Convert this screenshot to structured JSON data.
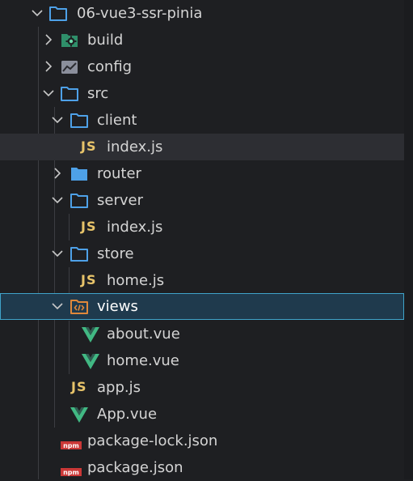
{
  "colors": {
    "background": "#1e1f22",
    "hover_row": "#2d2e33",
    "selected_row": "#1f3a4d",
    "selected_border": "#3fa3c9",
    "folder_blue": "#4ea1e8",
    "js_yellow": "#e8c46a",
    "vue_green": "#41b883",
    "npm_red": "#cb3837"
  },
  "tree": {
    "root": {
      "label": "06-vue3-ssr-pinia",
      "icon": "folder-open-icon"
    },
    "build": {
      "label": "build",
      "icon": "folder-build-icon"
    },
    "config": {
      "label": "config",
      "icon": "folder-config-icon"
    },
    "src": {
      "label": "src",
      "icon": "folder-open-icon"
    },
    "client": {
      "label": "client",
      "icon": "folder-open-icon"
    },
    "client_index": {
      "label": "index.js",
      "icon": "javascript-icon",
      "icon_text": "JS"
    },
    "router": {
      "label": "router",
      "icon": "folder-closed-icon"
    },
    "server": {
      "label": "server",
      "icon": "folder-open-icon"
    },
    "server_index": {
      "label": "index.js",
      "icon": "javascript-icon",
      "icon_text": "JS"
    },
    "store": {
      "label": "store",
      "icon": "folder-open-icon"
    },
    "store_home": {
      "label": "home.js",
      "icon": "javascript-icon",
      "icon_text": "JS"
    },
    "views": {
      "label": "views",
      "icon": "folder-views-icon"
    },
    "about_vue": {
      "label": "about.vue",
      "icon": "vue-icon"
    },
    "home_vue": {
      "label": "home.vue",
      "icon": "vue-icon"
    },
    "app_js": {
      "label": "app.js",
      "icon": "javascript-icon",
      "icon_text": "JS"
    },
    "app_vue": {
      "label": "App.vue",
      "icon": "vue-icon"
    },
    "package_lock": {
      "label": "package-lock.json",
      "icon": "npm-icon",
      "icon_text": "npm"
    },
    "package_json": {
      "label": "package.json",
      "icon": "npm-icon",
      "icon_text": "npm"
    }
  }
}
